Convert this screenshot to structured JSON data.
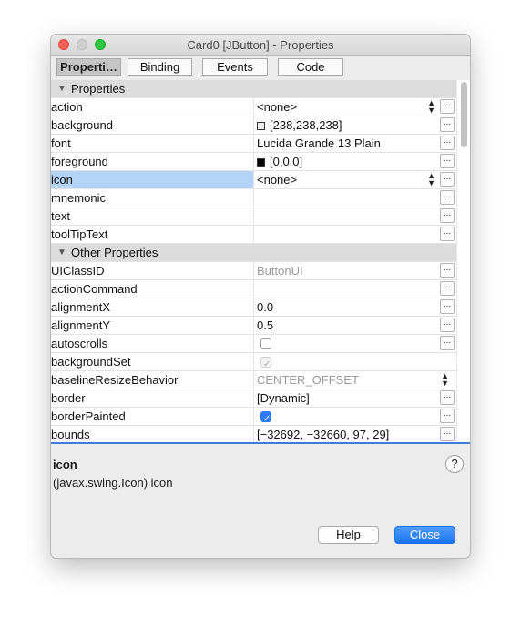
{
  "window": {
    "title": "Card0 [JButton] - Properties"
  },
  "tabs": [
    {
      "label": "Properti…",
      "active": true
    },
    {
      "label": "Binding",
      "active": false
    },
    {
      "label": "Events",
      "active": false
    },
    {
      "label": "Code",
      "active": false
    }
  ],
  "sections": {
    "properties": "Properties",
    "other": "Other Properties"
  },
  "props": {
    "action": {
      "name": "action",
      "value": "<none>"
    },
    "background": {
      "name": "background",
      "value": "[238,238,238]",
      "swatch": "#eeeeee"
    },
    "font": {
      "name": "font",
      "value": "Lucida Grande 13 Plain"
    },
    "foreground": {
      "name": "foreground",
      "value": "[0,0,0]",
      "swatch": "#000000"
    },
    "icon": {
      "name": "icon",
      "value": "<none>"
    },
    "mnemonic": {
      "name": "mnemonic",
      "value": ""
    },
    "text": {
      "name": "text",
      "value": ""
    },
    "toolTipText": {
      "name": "toolTipText",
      "value": ""
    }
  },
  "other": {
    "UIClassID": {
      "name": "UIClassID",
      "value": "ButtonUI"
    },
    "actionCommand": {
      "name": "actionCommand",
      "value": ""
    },
    "alignmentX": {
      "name": "alignmentX",
      "value": "0.0"
    },
    "alignmentY": {
      "name": "alignmentY",
      "value": "0.5"
    },
    "autoscrolls": {
      "name": "autoscrolls",
      "checked": false
    },
    "backgroundSet": {
      "name": "backgroundSet",
      "checked": true
    },
    "baselineResizeBehavior": {
      "name": "baselineResizeBehavior",
      "value": "CENTER_OFFSET"
    },
    "border": {
      "name": "border",
      "value": "[Dynamic]"
    },
    "borderPainted": {
      "name": "borderPainted",
      "checked": true
    },
    "bounds": {
      "name": "bounds",
      "value": "[−32692, −32660, 97, 29]"
    }
  },
  "editor_button": "...",
  "description": {
    "title": "icon",
    "text": "(javax.swing.Icon) icon"
  },
  "buttons": {
    "help": "Help",
    "close": "Close",
    "help_icon": "?"
  },
  "colors": {
    "selection": "#b3d3f7",
    "primary_button": "#1a74f0",
    "checkbox_on": "#2b7cf6"
  }
}
